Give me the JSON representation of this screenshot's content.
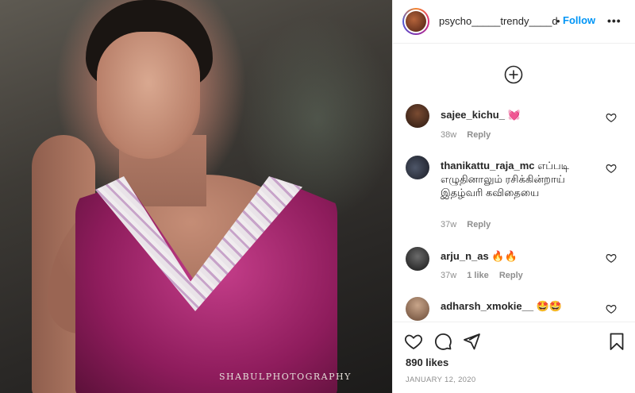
{
  "post": {
    "image_watermark": "SHABULPHOTOGRAPHY"
  },
  "header": {
    "username": "psycho_____trendy____dh",
    "separator": "•",
    "follow_label": "Follow",
    "more_label": "•••"
  },
  "comments": [
    {
      "username": "sajee_kichu_",
      "text": "💓",
      "time": "38w",
      "likes": "",
      "reply_label": "Reply"
    },
    {
      "username": "thanikattu_raja_mc",
      "text": "எப்படி எழுதினாலும் ரசிக்கின்றாய் இதழ்வரி கவிதையை",
      "time": "37w",
      "likes": "",
      "reply_label": "Reply"
    },
    {
      "username": "arju_n_as",
      "text": "🔥🔥",
      "time": "37w",
      "likes": "1 like",
      "reply_label": "Reply"
    },
    {
      "username": "adharsh_xmokie__",
      "text": "🤩🤩",
      "time": "",
      "likes": "",
      "reply_label": ""
    }
  ],
  "actions": {
    "likes_count": "890 likes",
    "date": "JANUARY 12, 2020"
  },
  "icons": {
    "like": "heart-icon",
    "comment": "comment-icon",
    "share": "paper-plane-icon",
    "save": "bookmark-icon",
    "load_more": "plus-circle-icon",
    "more": "more-options-icon"
  },
  "colors": {
    "link_blue": "#0095f6",
    "meta_gray": "#8e8e8e",
    "text": "#262626"
  }
}
